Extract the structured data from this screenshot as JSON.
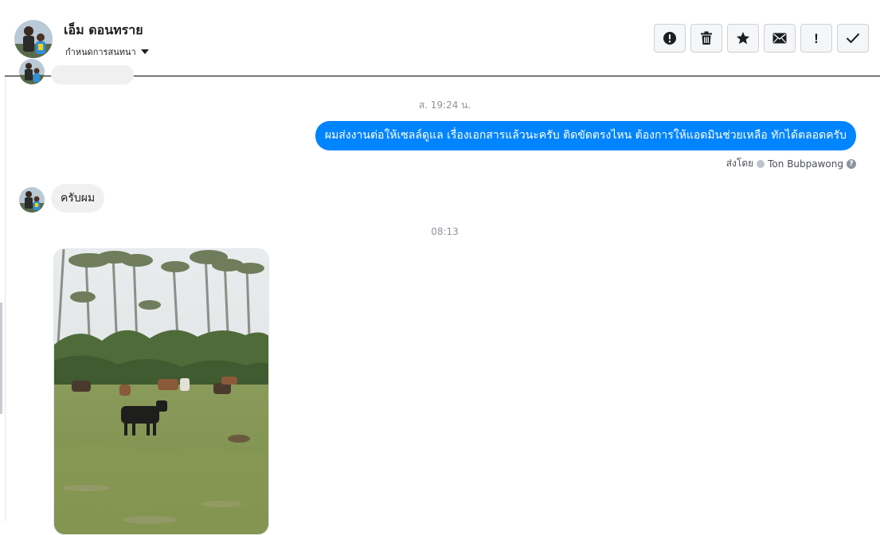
{
  "header": {
    "contact_name": "เอ็ม ดอนทราย",
    "conversation_setting": "กำหนดการสนทนา",
    "toolbar": [
      {
        "name": "report-button",
        "icon": "alert-circle-icon"
      },
      {
        "name": "delete-button",
        "icon": "trash-icon"
      },
      {
        "name": "star-button",
        "icon": "star-icon"
      },
      {
        "name": "mark-unread-button",
        "icon": "envelope-icon"
      },
      {
        "name": "important-button",
        "icon": "exclamation-icon",
        "glyph": "!"
      },
      {
        "name": "done-button",
        "icon": "check-icon"
      }
    ]
  },
  "messages": {
    "timestamp_1": "ส. 19:24 น.",
    "outgoing_1": "ผมส่งงานต่อให้เซลล์ดูแล เรื่องเอกสารแล้วนะครับ ติดขัดตรงไหน ต้องการให้แอดมินช่วยเหลือ ทักได้ตลอดครับ",
    "sent_by_label": "ส่งโดย",
    "sent_by_name": "Ton Bubpawong",
    "help_glyph": "?",
    "incoming_1": "ครับผม",
    "timestamp_2": "08:13"
  },
  "colors": {
    "accent": "#0084ff",
    "incoming_bubble": "#f0f0f0",
    "timestamp_text": "#8d949e"
  }
}
